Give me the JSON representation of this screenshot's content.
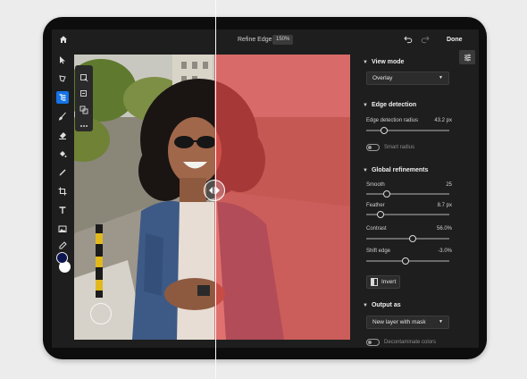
{
  "topbar": {
    "title": "Refine Edge",
    "zoom": "150%",
    "done_label": "Done"
  },
  "panel": {
    "view_mode": {
      "heading": "View mode",
      "value": "Overlay"
    },
    "edge_detection": {
      "heading": "Edge detection",
      "radius_label": "Edge detection radius",
      "radius_value": "43.2 px",
      "radius_level": 0.22,
      "smart_radius_label": "Smart radius"
    },
    "global": {
      "heading": "Global refinements",
      "smooth": {
        "label": "Smooth",
        "value": "25",
        "level": 0.25
      },
      "feather": {
        "label": "Feather",
        "value": "8.7 px",
        "level": 0.17
      },
      "contrast": {
        "label": "Contrast",
        "value": "56.0%",
        "level": 0.56
      },
      "shift_edge": {
        "label": "Shift edge",
        "value": "-3.0%",
        "level": 0.47
      }
    },
    "invert_label": "Invert",
    "output": {
      "heading": "Output as",
      "value": "New layer with mask",
      "decontaminate_label": "Decontaminate colors"
    }
  },
  "colors": {
    "accent": "#1473e6",
    "overlay": "#de4646",
    "foreground": "#0b1550",
    "background": "#ffffff"
  },
  "icons": [
    "home-icon",
    "undo-icon",
    "redo-icon",
    "panel-settings-icon",
    "split-arrows-icon"
  ]
}
